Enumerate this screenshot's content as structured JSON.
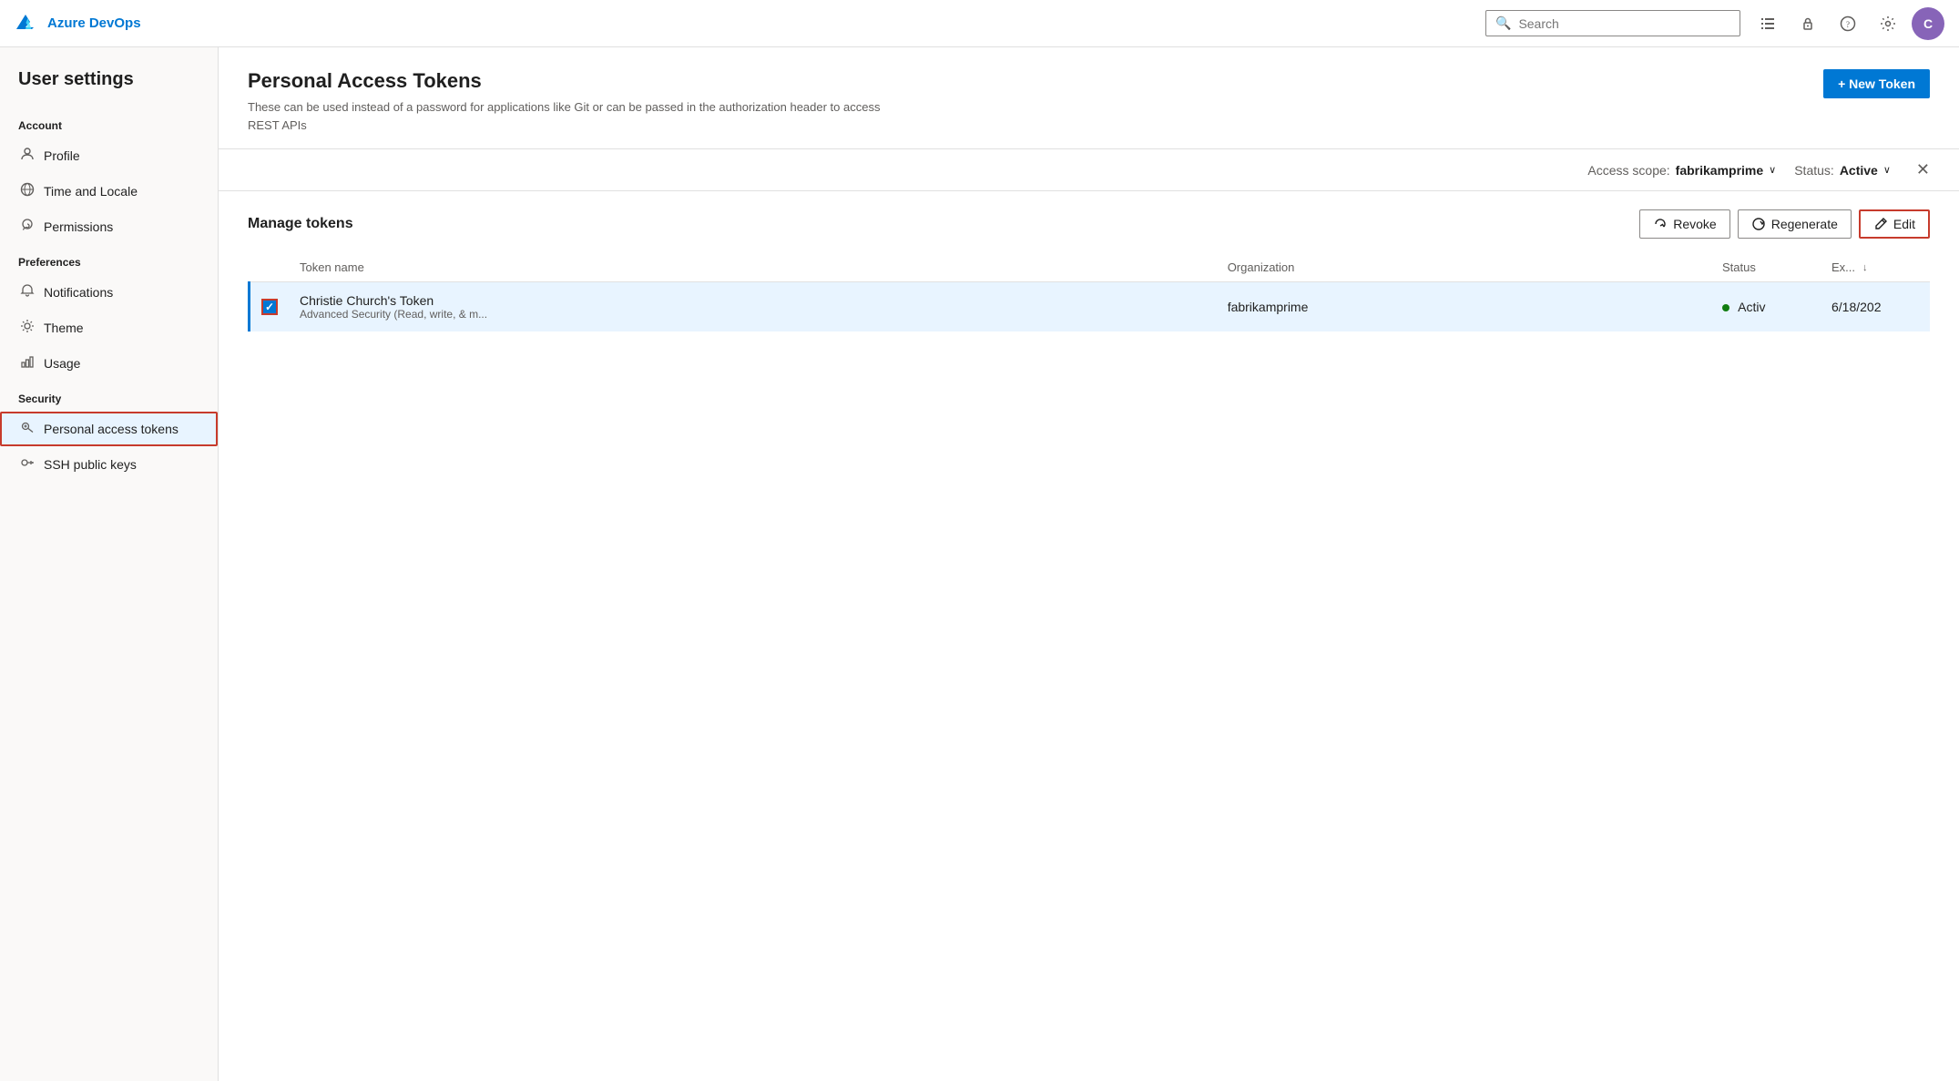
{
  "brand": {
    "name": "Azure DevOps",
    "icon_label": "azure-logo"
  },
  "topnav": {
    "search_placeholder": "Search",
    "icons": [
      "list-icon",
      "lock-icon",
      "help-icon",
      "settings-icon"
    ],
    "user_initials": "C"
  },
  "sidebar": {
    "title": "User settings",
    "sections": [
      {
        "header": "Account",
        "items": [
          {
            "id": "profile",
            "label": "Profile",
            "icon": "👤"
          },
          {
            "id": "time-locale",
            "label": "Time and Locale",
            "icon": "🌐"
          },
          {
            "id": "permissions",
            "label": "Permissions",
            "icon": "↺"
          }
        ]
      },
      {
        "header": "Preferences",
        "items": [
          {
            "id": "notifications",
            "label": "Notifications",
            "icon": "🔔"
          },
          {
            "id": "theme",
            "label": "Theme",
            "icon": "🎨"
          },
          {
            "id": "usage",
            "label": "Usage",
            "icon": "📊"
          }
        ]
      },
      {
        "header": "Security",
        "items": [
          {
            "id": "personal-access-tokens",
            "label": "Personal access tokens",
            "icon": "🔑",
            "active": true
          },
          {
            "id": "ssh-public-keys",
            "label": "SSH public keys",
            "icon": "🔒"
          }
        ]
      }
    ]
  },
  "page": {
    "title": "Personal Access Tokens",
    "subtitle": "These can be used instead of a password for applications like Git or can be passed in the authorization header to access REST APIs",
    "new_token_label": "+ New Token"
  },
  "filter_bar": {
    "access_scope_label": "Access scope:",
    "access_scope_value": "fabrikamprime",
    "status_label": "Status:",
    "status_value": "Active"
  },
  "manage_tokens": {
    "title": "Manage tokens",
    "revoke_label": "Revoke",
    "regenerate_label": "Regenerate",
    "edit_label": "Edit"
  },
  "table": {
    "columns": [
      {
        "id": "checkbox",
        "label": ""
      },
      {
        "id": "name",
        "label": "Token name"
      },
      {
        "id": "org",
        "label": "Organization"
      },
      {
        "id": "status",
        "label": "Status"
      },
      {
        "id": "expiry",
        "label": "Ex..."
      }
    ],
    "rows": [
      {
        "id": "row-1",
        "selected": true,
        "checked": true,
        "name_primary": "Christie Church's Token",
        "name_secondary": "Advanced Security (Read, write, & m...",
        "organization": "fabrikamprime",
        "status": "Activ",
        "status_color": "#107c10",
        "expiry": "6/18/202"
      }
    ]
  }
}
